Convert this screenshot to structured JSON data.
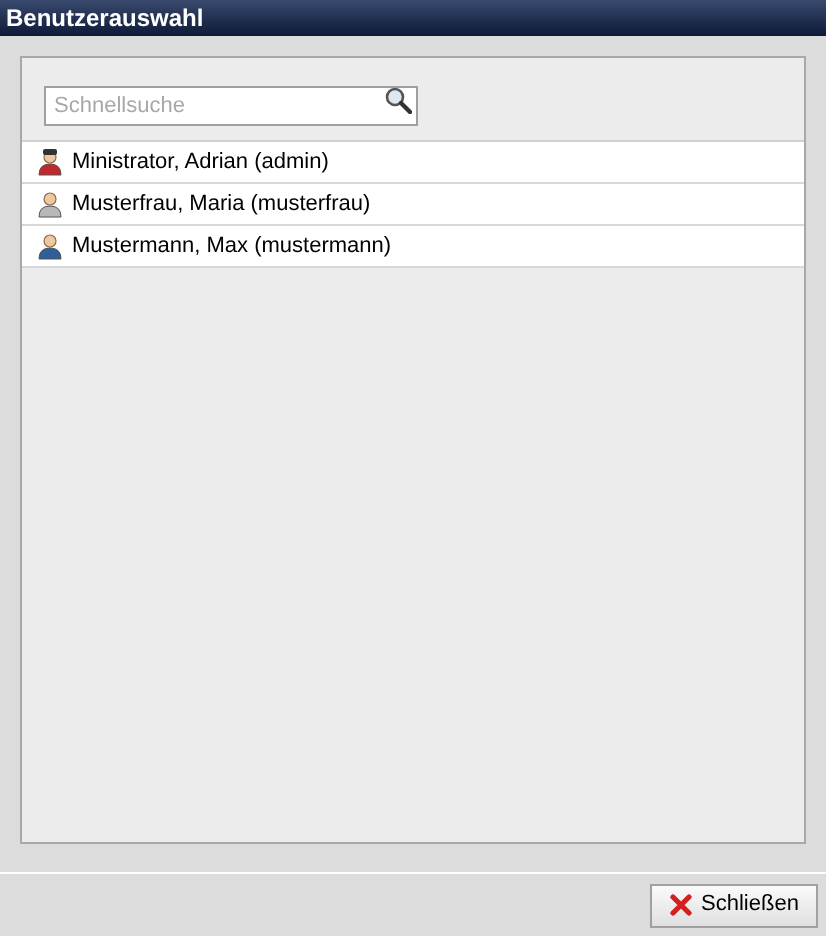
{
  "window": {
    "title": "Benutzerauswahl"
  },
  "search": {
    "placeholder": "Schnellsuche"
  },
  "users": [
    {
      "label": "Ministrator, Adrian (admin)",
      "kind": "admin",
      "color": "#c0282d"
    },
    {
      "label": "Musterfrau, Maria (musterfrau)",
      "kind": "user",
      "color": "#b8b8b8"
    },
    {
      "label": "Mustermann, Max (mustermann)",
      "kind": "user",
      "color": "#2f5f9a"
    }
  ],
  "buttons": [
    {
      "label": "Schließen"
    }
  ]
}
